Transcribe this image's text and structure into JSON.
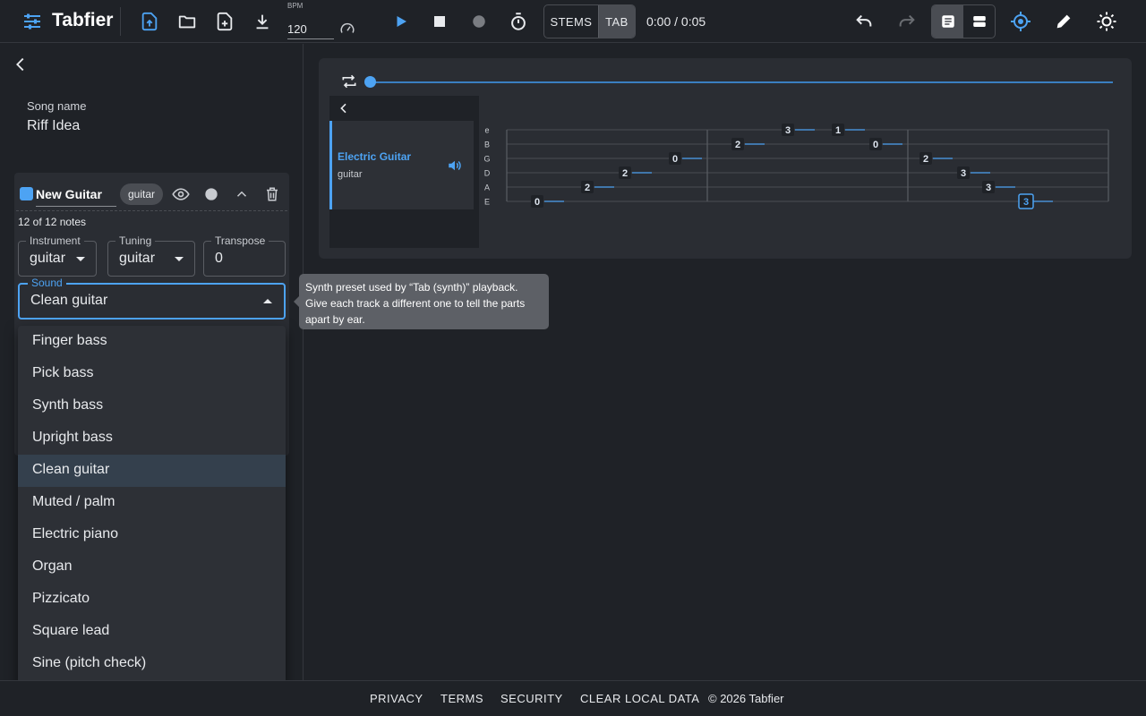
{
  "app": {
    "title": "Tabfier"
  },
  "toolbar": {
    "bpm_label": "BPM",
    "bpm_value": "120",
    "mode_stems": "STEMS",
    "mode_tab": "TAB",
    "time": "0:00 / 0:05",
    "accent": "#4da3f3"
  },
  "song": {
    "label": "Song name",
    "value": "Riff Idea"
  },
  "track": {
    "name": "New Guitar",
    "badge": "guitar",
    "color": "#4da3f3",
    "notes_count": "12 of 12 notes",
    "instrument": {
      "label": "Instrument",
      "value": "guitar"
    },
    "tuning": {
      "label": "Tuning",
      "value": "guitar"
    },
    "transpose": {
      "label": "Transpose",
      "value": "0"
    },
    "sound": {
      "label": "Sound",
      "value": "Clean guitar"
    }
  },
  "sound_options": [
    "Finger bass",
    "Pick bass",
    "Synth bass",
    "Upright bass",
    "Clean guitar",
    "Muted / palm",
    "Electric piano",
    "Organ",
    "Pizzicato",
    "Square lead",
    "Sine (pitch check)"
  ],
  "sound_selected_index": 4,
  "tooltip": {
    "line1": "Synth preset used by “Tab (synth)” playback.",
    "line2": "Give each track a different one to tell the parts",
    "line3": "apart by ear."
  },
  "tab": {
    "track_name": "Electric Guitar",
    "track_sub": "guitar",
    "playhead": 0,
    "string_names": [
      "e",
      "B",
      "G",
      "D",
      "A",
      "E"
    ],
    "notes": [
      {
        "s": 5,
        "t": 0.0,
        "f": "0"
      },
      {
        "s": 4,
        "t": 1.0,
        "f": "2"
      },
      {
        "s": 3,
        "t": 1.75,
        "f": "2"
      },
      {
        "s": 2,
        "t": 2.75,
        "f": "0"
      },
      {
        "s": 1,
        "t": 4.0,
        "f": "2"
      },
      {
        "s": 0,
        "t": 5.0,
        "f": "3"
      },
      {
        "s": 0,
        "t": 6.0,
        "f": "1"
      },
      {
        "s": 1,
        "t": 6.75,
        "f": "0"
      },
      {
        "s": 2,
        "t": 7.75,
        "f": "2"
      },
      {
        "s": 3,
        "t": 8.5,
        "f": "3"
      },
      {
        "s": 4,
        "t": 9.0,
        "f": "3"
      },
      {
        "s": 5,
        "t": 9.75,
        "f": "3",
        "selected": true
      }
    ]
  },
  "footer": {
    "privacy": "PRIVACY",
    "terms": "TERMS",
    "security": "SECURITY",
    "clear": "CLEAR LOCAL DATA",
    "copyright": "© 2026 Tabfier"
  }
}
